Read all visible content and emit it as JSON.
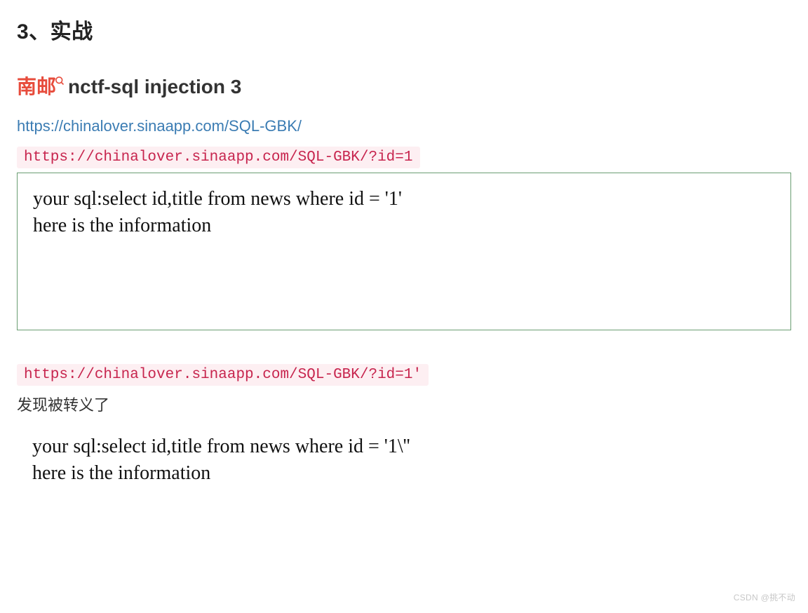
{
  "heading1": "3、实战",
  "heading2": {
    "highlight": "南邮",
    "rest": "nctf-sql injection 3"
  },
  "link_text": "https://chinalover.sinaapp.com/SQL-GBK/",
  "code1": "https://chinalover.sinaapp.com/SQL-GBK/?id=1",
  "figure1": {
    "line1": "your sql:select id,title from news where id = '1'",
    "line2": "here is the information"
  },
  "code2": "https://chinalover.sinaapp.com/SQL-GBK/?id=1'",
  "para1": "发现被转义了",
  "figure2": {
    "line1": "your sql:select id,title from news where id = '1\\''",
    "line2": "here is the information"
  },
  "watermark": "CSDN @挑不动"
}
